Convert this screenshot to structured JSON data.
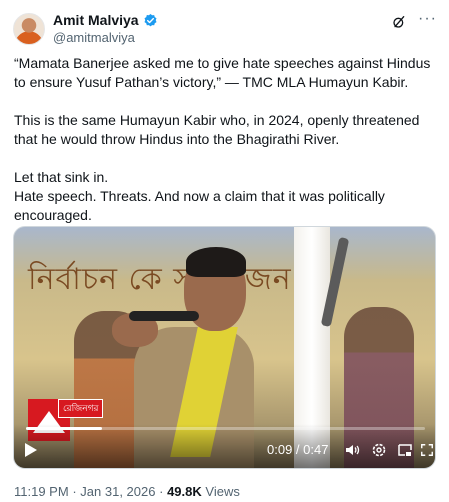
{
  "author": {
    "display_name": "Amit Malviya",
    "handle": "@amitmalviya",
    "verified_color": "#1d9bf0"
  },
  "icons": {
    "grok": "grok-icon",
    "more": "more-options-icon",
    "play": "play-icon",
    "volume": "volume-icon",
    "settings": "settings-icon",
    "pip": "picture-in-picture-icon",
    "fullscreen": "fullscreen-icon"
  },
  "tweet": {
    "paragraphs": [
      "“Mamata Banerjee asked me to give hate speeches against Hindus to ensure Yusuf Pathan’s victory,” — TMC MLA Humayun Kabir.",
      "This is the same Humayun Kabir who, in 2024, openly threatened that he would throw Hindus into the Bhagirathi River.",
      "Let that sink in.",
      "Hate speech. Threats. And now a claim that it was politically encouraged."
    ]
  },
  "video": {
    "banner_text": "নির্বাচন কে সা... জন",
    "channel_label": "রেজিনগর",
    "time_display": "0:09 / 0:47",
    "progress_fraction": 0.19
  },
  "meta": {
    "time": "11:19 PM",
    "date": "Jan 31, 2026",
    "separator": "·",
    "views_count": "49.8K",
    "views_label": "Views"
  }
}
